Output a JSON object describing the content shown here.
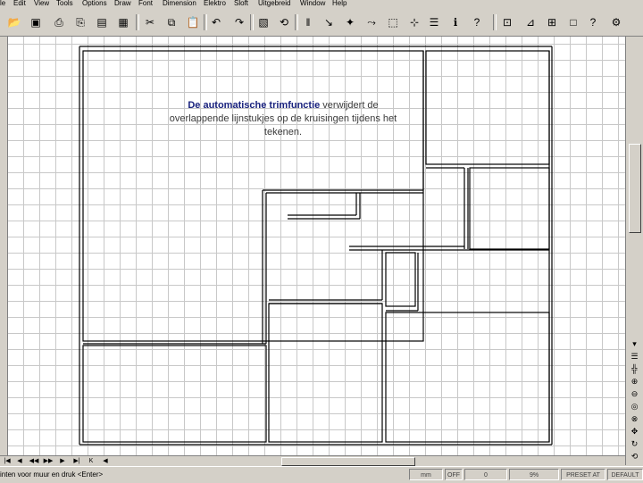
{
  "menu": [
    "le",
    "Edit",
    "View",
    "Tools",
    "Options",
    "Draw",
    "Font",
    "Dimension",
    "Elektro",
    "Sloft",
    "Uitgebreid",
    "Window",
    "Help"
  ],
  "toolbar_icons": [
    "open-folder-icon",
    "save-icon",
    "print-preview-icon",
    "print-icon",
    "cut-icon",
    "copy-icon",
    "paste-icon",
    "undo-icon",
    "redo-icon",
    "properties-icon",
    "rotate-icon",
    "wall-tool-icon",
    "line-tool-icon",
    "node-tool-icon",
    "select-box-icon",
    "snap-icon",
    "layers-icon",
    "info-icon",
    "help-icon",
    "zoom-window-icon",
    "measure-icon",
    "grid-icon",
    "rectangle-icon",
    "question-icon",
    "settings-icon"
  ],
  "annotation": {
    "highlight": "De automatische trimfunctie",
    "text": " verwijdert de overlappende lijnstukjes op de kruisingen tijdens het tekenen."
  },
  "sheet_tabs": [
    "|◀",
    "◀",
    "◀◀",
    "▶▶",
    "▶",
    "▶|",
    "K",
    "◀"
  ],
  "status": {
    "prompt": "inten voor muur en druk <Enter>",
    "units": "mm",
    "snap": "OFF",
    "value": "0",
    "zoom": "9%",
    "reset": "PRESET AT",
    "layer": "DEFAULT"
  }
}
